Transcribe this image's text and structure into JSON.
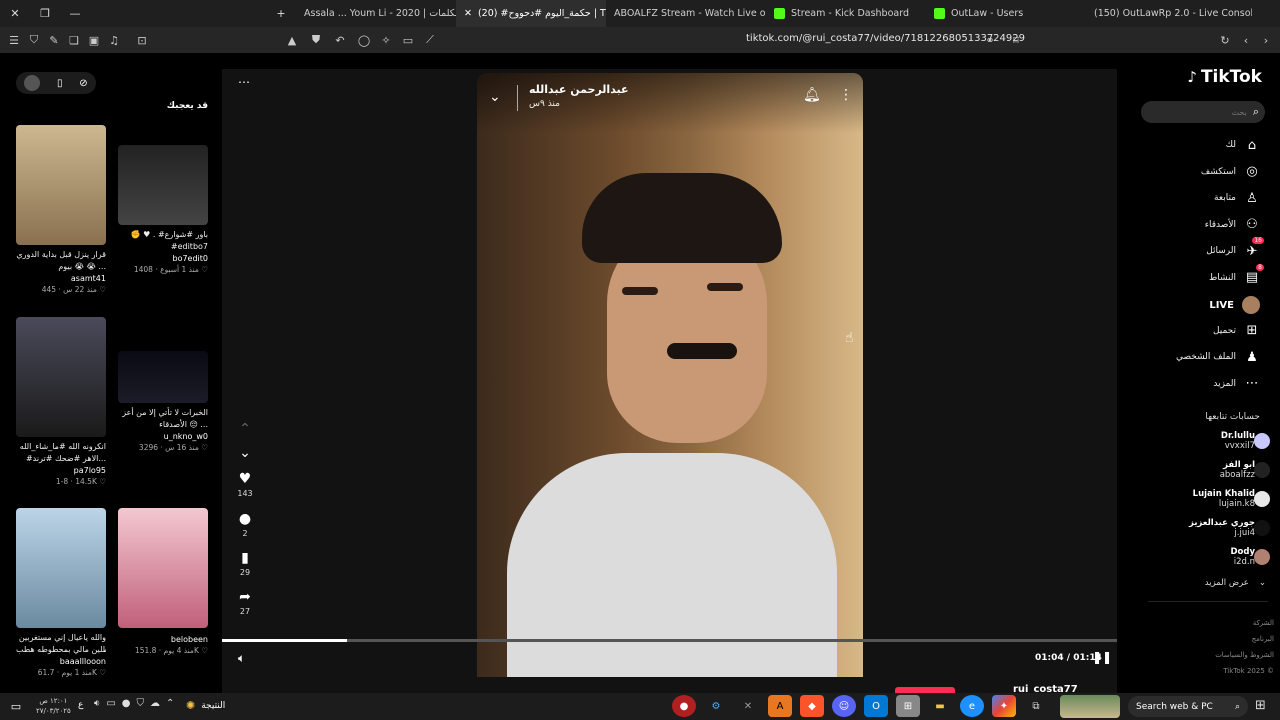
{
  "tabs": [
    {
      "label": "Assala ... Youm Li - 2020 | بالكلمات - ...",
      "color": "#ff0000"
    },
    {
      "label": "(20) #حكمة_اليوم #دحووح | TikTok",
      "color": "#111111",
      "active": true
    },
    {
      "label": "ABOALFZ Stream - Watch Live on Kick",
      "color": "#53fc18"
    },
    {
      "label": "Stream - Kick Dashboard",
      "color": "#53fc18"
    },
    {
      "label": "OutLaw - Users",
      "color": "#53fc18"
    },
    {
      "label": "(150) OutLawRp 2.0 - Live Console",
      "color": "#2ecc71"
    }
  ],
  "url": "tiktok.com/@rui_costa77/video/7181226805133724929",
  "logo": "TikTok",
  "search": {
    "placeholder": "بحث"
  },
  "nav": [
    {
      "label": "لك",
      "icon": "⌂",
      "name": "home"
    },
    {
      "label": "استكشف",
      "icon": "◎",
      "name": "explore"
    },
    {
      "label": "متابعة",
      "icon": "♙",
      "name": "following"
    },
    {
      "label": "الأصدقاء",
      "icon": "⚇",
      "name": "friends"
    },
    {
      "label": "الرسائل",
      "icon": "✈",
      "name": "messages",
      "badge": "16"
    },
    {
      "label": "النشاط",
      "icon": "▤",
      "name": "activity",
      "badge": "8"
    },
    {
      "label": "LIVE",
      "icon": "●",
      "name": "live"
    },
    {
      "label": "تحميل",
      "icon": "⊞",
      "name": "upload"
    },
    {
      "label": "الملف الشخصي",
      "icon": "♟",
      "name": "profile"
    },
    {
      "label": "المزيد",
      "icon": "⋯",
      "name": "more"
    }
  ],
  "following_title": "حسابات تتابعها",
  "following": [
    {
      "name": "Dr.lullu",
      "handle": "vvxxil7",
      "color": "#c8c8ff"
    },
    {
      "name": "ابو الفز",
      "handle": "aboalfzz",
      "color": "#222222"
    },
    {
      "name": "Lujain Khalid",
      "handle": "lujain.k8",
      "color": "#e8e8e8"
    },
    {
      "name": "جوري عبدالعزيز",
      "handle": "j.jui4",
      "color": "#111111"
    },
    {
      "name": "Dody",
      "handle": "i2d.n",
      "color": "#b08070"
    }
  ],
  "see_more": "عرض المزيد",
  "footer": [
    "الشركة",
    "البرنامج",
    "الشروط والسياسات"
  ],
  "copyright": "TikTok 2025 ©",
  "video": {
    "author": "عبدالرحمن عبدالله",
    "time_ago": "منذ ٩س",
    "current": "01:04",
    "duration": "01:14",
    "progress": 0.14
  },
  "actions": {
    "likes": "143",
    "comments": "2",
    "saves": "29",
    "shares": "27"
  },
  "suggested_title": "قد يعجبك",
  "cards": [
    {
      "title": "قرار ينزل قبل بداية الدوري",
      "title2": "بيوم 😭 😭 ...",
      "user": "asamt41",
      "likes": "445",
      "when": "منذ 22 س",
      "bg": "linear-gradient(#ccb890,#8a7050)"
    },
    {
      "title": "✊ ♥ . #باور #شوارع",
      "title2": "#editbo7",
      "user": "bo7edit0",
      "likes": "1408",
      "when": "منذ 1 أسبوع",
      "bg": "linear-gradient(#222,#444)"
    },
    {
      "title": "انكرونه الله #ما_شاء_الله",
      "title2": "#الاهر #ضحك #ترند...",
      "user": "pa7lo95",
      "likes": "14.5K",
      "when": "1-8",
      "bg": "linear-gradient(#4a4a5a,#1a1a1a)"
    },
    {
      "title": "الخبرات لا تأتي إلا من أعز",
      "title2": "الأصدقاء 😔 ...",
      "user": "u_nkno_w0",
      "likes": "3296",
      "when": "منذ 16 س",
      "bg": "linear-gradient(#0a0a14,#1c1c28)"
    },
    {
      "title": "والله ياعيال إني مستغربين",
      "title2": "وعاطلين مالي بمحطوطه هطب...",
      "user": "baaalllooon",
      "likes": "61.7K",
      "when": "منذ 1 يوم",
      "bg": "linear-gradient(#bcd4e8,#6a8aa0)"
    },
    {
      "title": "",
      "title2": "",
      "user": "belobeen",
      "likes": "151.8K",
      "when": "منذ 4 يوم",
      "bg": "linear-gradient(#f4c8d0,#c0607a)"
    }
  ],
  "video_bottom_author": "rui_costa77",
  "taskbar": {
    "weather": "النتيجة",
    "time": "١٢:٠١ ص",
    "date": "٢٧/٠٣/٢٠٢٥",
    "search": "Search web & PC",
    "lang": "ع"
  }
}
